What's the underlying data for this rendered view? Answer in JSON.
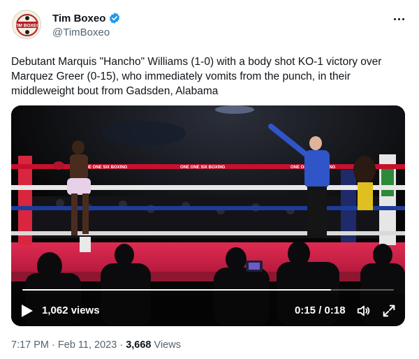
{
  "author": {
    "name": "Tim Boxeo",
    "handle": "@TimBoxeo",
    "avatar_text": "TIM BOXEO",
    "verified": true
  },
  "tweet": {
    "text": "Debutant Marquis \"Hancho\" Williams (1-0) with a body shot KO-1 victory over Marquez Greer (0-15), who immediately vomits from the punch, in their middleweight bout from Gadsden, Alabama"
  },
  "video": {
    "views": "1,062 views",
    "time": "0:15 / 0:18",
    "progress": 0.83,
    "ring_banner_text": "ONE ONE SIX BOXING"
  },
  "meta": {
    "time": "7:17 PM",
    "separator": "·",
    "date": "Feb 11, 2023",
    "views_count": "3,668",
    "views_label": "Views"
  },
  "icons": {
    "verified": "verified-badge-icon",
    "more": "more-options-icon",
    "play": "play-icon",
    "volume": "volume-icon",
    "fullscreen": "fullscreen-icon"
  },
  "colors": {
    "verified_blue": "#1d9bf0",
    "ring_canvas": "#d8224a",
    "ring_rope": "#c8102e",
    "referee_shirt": "#2f55c8"
  }
}
